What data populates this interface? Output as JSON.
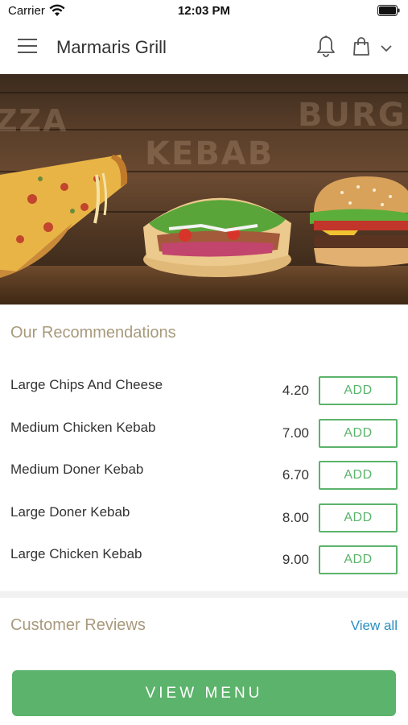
{
  "status_bar": {
    "carrier": "Carrier",
    "time": "12:03 PM"
  },
  "header": {
    "title": "Marmaris Grill",
    "icons": [
      "menu-icon",
      "bell-icon",
      "bag-icon",
      "chevron-down-icon"
    ]
  },
  "hero": {
    "words": [
      "ZZA",
      "KEBAB",
      "BURG"
    ]
  },
  "recommendations": {
    "title": "Our Recommendations",
    "items": [
      {
        "name": "Large Chips And Cheese",
        "price": "4.20",
        "button": "ADD"
      },
      {
        "name": "Medium Chicken Kebab",
        "price": "7.00",
        "button": "ADD"
      },
      {
        "name": "Medium Doner Kebab",
        "price": "6.70",
        "button": "ADD"
      },
      {
        "name": "Large Doner Kebab",
        "price": "8.00",
        "button": "ADD"
      },
      {
        "name": "Large Chicken Kebab",
        "price": "9.00",
        "button": "ADD"
      }
    ]
  },
  "reviews": {
    "title": "Customer Reviews",
    "view_all": "View all"
  },
  "footer": {
    "view_menu": "VIEW MENU"
  },
  "colors": {
    "accent_green": "#5cb36b",
    "section_title": "#a89a7c",
    "link_blue": "#2a8fc0"
  }
}
